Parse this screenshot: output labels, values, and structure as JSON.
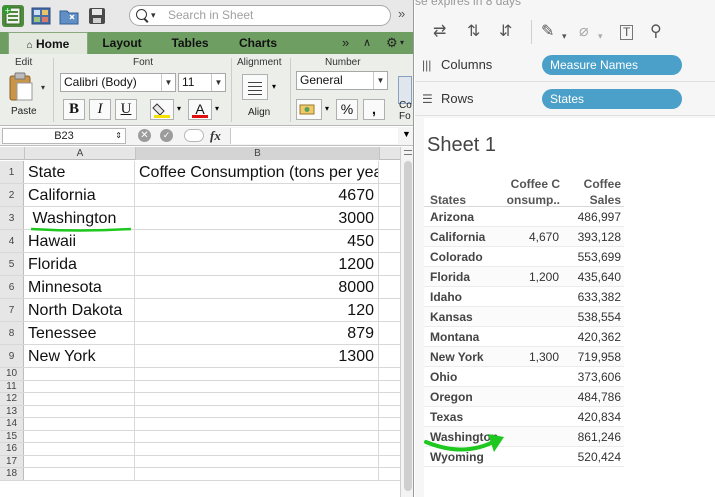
{
  "excel": {
    "search_placeholder": "Search in Sheet",
    "overflow": "»",
    "ribbon_tabs": [
      {
        "label": "Home",
        "active": true
      },
      {
        "label": "Layout",
        "active": false
      },
      {
        "label": "Tables",
        "active": false
      },
      {
        "label": "Charts",
        "active": false
      }
    ],
    "ribbon_more": "»",
    "groups": {
      "edit": "Edit",
      "font": "Font",
      "alignment": "Alignment",
      "number": "Number"
    },
    "paste_label": "Paste",
    "align_label": "Align",
    "font_name": "Calibri (Body)",
    "font_size": "11",
    "number_format": "General",
    "bold": "B",
    "italic": "I",
    "underline": "U",
    "font_color_glyph": "A",
    "percent": "%",
    "comma": ",",
    "cond_format_partial": "Co Fo",
    "name_box": "B23",
    "fx": "fx",
    "columns": [
      "A",
      "B"
    ],
    "rows": [
      {
        "num": "1",
        "a": "State",
        "b": "Coffee Consumption (tons per year)",
        "b_align": "left"
      },
      {
        "num": "2",
        "a": "California",
        "b": "4670",
        "b_align": "right"
      },
      {
        "num": "3",
        "a": " Washington",
        "b": "3000",
        "b_align": "right"
      },
      {
        "num": "4",
        "a": "Hawaii",
        "b": "450",
        "b_align": "right"
      },
      {
        "num": "5",
        "a": "Florida",
        "b": "1200",
        "b_align": "right"
      },
      {
        "num": "6",
        "a": "Minnesota",
        "b": "8000",
        "b_align": "right"
      },
      {
        "num": "7",
        "a": "North Dakota",
        "b": "120",
        "b_align": "right"
      },
      {
        "num": "8",
        "a": "Tenessee",
        "b": "879",
        "b_align": "right"
      },
      {
        "num": "9",
        "a": "New York",
        "b": "1300",
        "b_align": "right"
      },
      {
        "num": "10",
        "a": "",
        "b": "",
        "b_align": "right"
      },
      {
        "num": "11",
        "a": "",
        "b": "",
        "b_align": "right"
      },
      {
        "num": "12",
        "a": "",
        "b": "",
        "b_align": "right"
      },
      {
        "num": "13",
        "a": "",
        "b": "",
        "b_align": "right"
      },
      {
        "num": "14",
        "a": "",
        "b": "",
        "b_align": "right"
      },
      {
        "num": "15",
        "a": "",
        "b": "",
        "b_align": "right"
      },
      {
        "num": "16",
        "a": "",
        "b": "",
        "b_align": "right"
      },
      {
        "num": "17",
        "a": "",
        "b": "",
        "b_align": "right"
      },
      {
        "num": "18",
        "a": "",
        "b": "",
        "b_align": "right"
      }
    ],
    "accent_tabs": "#6e9e62",
    "annotation_color": "#1ec81e"
  },
  "tableau": {
    "trial_notice": "se expires in 8 days",
    "columns_label": "Columns",
    "columns_pill": "Measure Names",
    "rows_label": "Rows",
    "rows_pill": "States",
    "pill_color": "#4aa0c9",
    "sheet_title": "Sheet 1",
    "headers": {
      "states": "States",
      "coffee_c": [
        "Coffee C",
        "onsump.."
      ],
      "coffee_sales": [
        "Coffee",
        "Sales"
      ]
    },
    "rows": [
      {
        "state": "Arizona",
        "consumption": "",
        "sales": "486,997"
      },
      {
        "state": "California",
        "consumption": "4,670",
        "sales": "393,128"
      },
      {
        "state": "Colorado",
        "consumption": "",
        "sales": "553,699"
      },
      {
        "state": "Florida",
        "consumption": "1,200",
        "sales": "435,640"
      },
      {
        "state": "Idaho",
        "consumption": "",
        "sales": "633,382"
      },
      {
        "state": "Kansas",
        "consumption": "",
        "sales": "538,554"
      },
      {
        "state": "Montana",
        "consumption": "",
        "sales": "420,362"
      },
      {
        "state": "New York",
        "consumption": "1,300",
        "sales": "719,958"
      },
      {
        "state": "Ohio",
        "consumption": "",
        "sales": "373,606"
      },
      {
        "state": "Oregon",
        "consumption": "",
        "sales": "484,786"
      },
      {
        "state": "Texas",
        "consumption": "",
        "sales": "420,834"
      },
      {
        "state": "Washington",
        "consumption": "",
        "sales": "861,246"
      },
      {
        "state": "Wyoming",
        "consumption": "",
        "sales": "520,424"
      }
    ]
  }
}
